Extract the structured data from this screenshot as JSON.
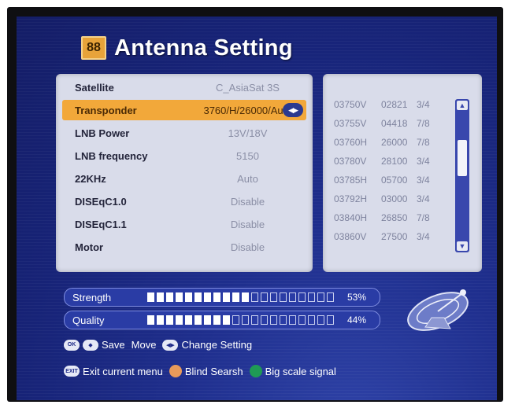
{
  "header": {
    "icon_text": "88",
    "title": "Antenna Setting"
  },
  "settings": [
    {
      "label": "Satellite",
      "value": "C_AsiaSat 3S"
    },
    {
      "label": "Transponder",
      "value": "3760/H/26000/Auto",
      "selected": true
    },
    {
      "label": "LNB Power",
      "value": "13V/18V"
    },
    {
      "label": "LNB frequency",
      "value": "5150"
    },
    {
      "label": "22KHz",
      "value": "Auto"
    },
    {
      "label": "DISEqC1.0",
      "value": "Disable"
    },
    {
      "label": "DISEqC1.1",
      "value": "Disable"
    },
    {
      "label": "Motor",
      "value": "Disable"
    }
  ],
  "transponders": [
    {
      "freq": "03750V",
      "sym": "02821",
      "fec": "3/4"
    },
    {
      "freq": "03755V",
      "sym": "04418",
      "fec": "7/8"
    },
    {
      "freq": "03760H",
      "sym": "26000",
      "fec": "7/8"
    },
    {
      "freq": "03780V",
      "sym": "28100",
      "fec": "3/4"
    },
    {
      "freq": "03785H",
      "sym": "05700",
      "fec": "3/4"
    },
    {
      "freq": "03792H",
      "sym": "03000",
      "fec": "3/4"
    },
    {
      "freq": "03840H",
      "sym": "26850",
      "fec": "7/8"
    },
    {
      "freq": "03860V",
      "sym": "27500",
      "fec": "3/4"
    }
  ],
  "signal": {
    "strength": {
      "label": "Strength",
      "percent_text": "53%",
      "level": 0.53
    },
    "quality": {
      "label": "Quality",
      "percent_text": "44%",
      "level": 0.44
    }
  },
  "help": {
    "ok_key": "OK",
    "save": "Save",
    "move": "Move",
    "change_setting": "Change Setting",
    "exit_key": "EXIT",
    "exit_menu": "Exit current menu",
    "blind_search": "Blind Searsh",
    "big_scale": "Big scale signal"
  },
  "colors": {
    "selection": "#f2a83a",
    "blind_search_key": "#e79a5a",
    "big_scale_key": "#1f9a55"
  }
}
